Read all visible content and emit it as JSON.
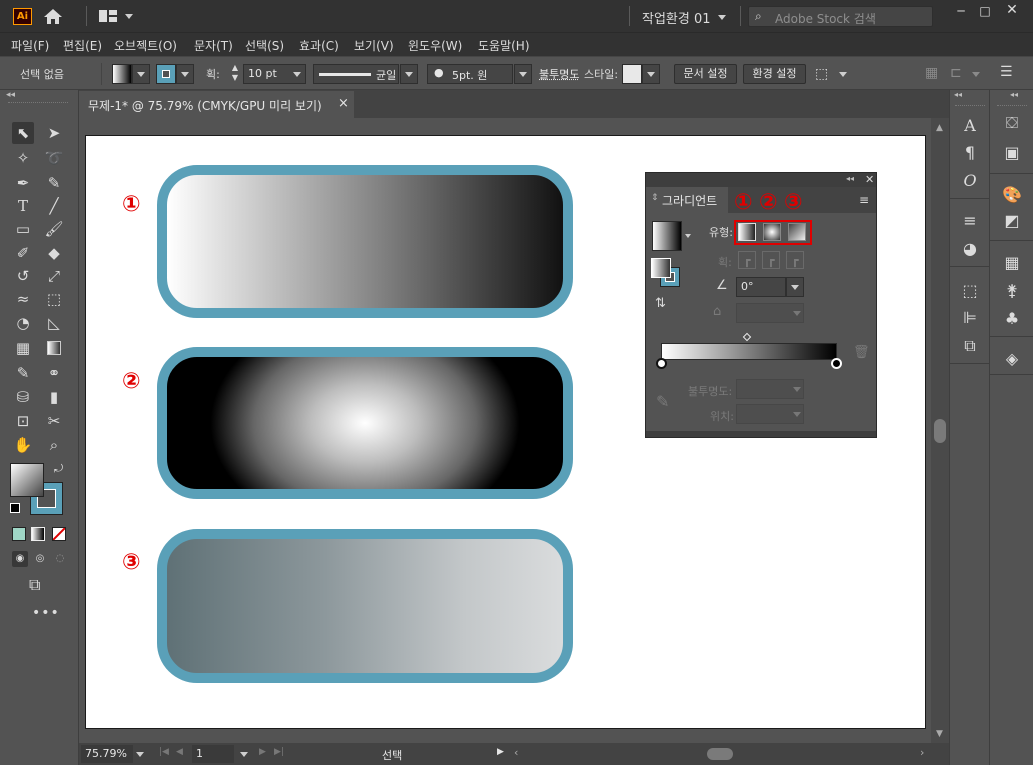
{
  "app": {
    "logo": "Ai",
    "workspace": "작업환경 01",
    "search_placeholder": "Adobe Stock 검색"
  },
  "menu": [
    "파일(F)",
    "편집(E)",
    "오브젝트(O)",
    "문자(T)",
    "선택(S)",
    "효과(C)",
    "보기(V)",
    "윈도우(W)",
    "도움말(H)"
  ],
  "control": {
    "selection": "선택 없음",
    "stroke_label": "획:",
    "stroke_value": "10 pt",
    "profile_label": "균일",
    "brush_label": "5pt. 원",
    "opacity_label": "불투명도",
    "style_label": "스타일:",
    "doc_setup": "문서 설정",
    "preferences": "환경 설정"
  },
  "document": {
    "tab_title": "무제-1* @ 75.79% (CMYK/GPU 미리 보기)",
    "close": "×"
  },
  "status": {
    "zoom": "75.79%",
    "artboard": "1",
    "tool": "선택"
  },
  "annotations": [
    "①",
    "②",
    "③"
  ],
  "gradient_panel": {
    "title": "그라디언트",
    "type_label": "유형:",
    "stroke_label": "획:",
    "angle_value": "0°",
    "opacity_label": "불투명도:",
    "location_label": "위치:"
  },
  "colors": {
    "accent": "#5aa0b8",
    "highlight": "#e00000",
    "app_bg": "#535353",
    "bar_bg": "#323232"
  }
}
